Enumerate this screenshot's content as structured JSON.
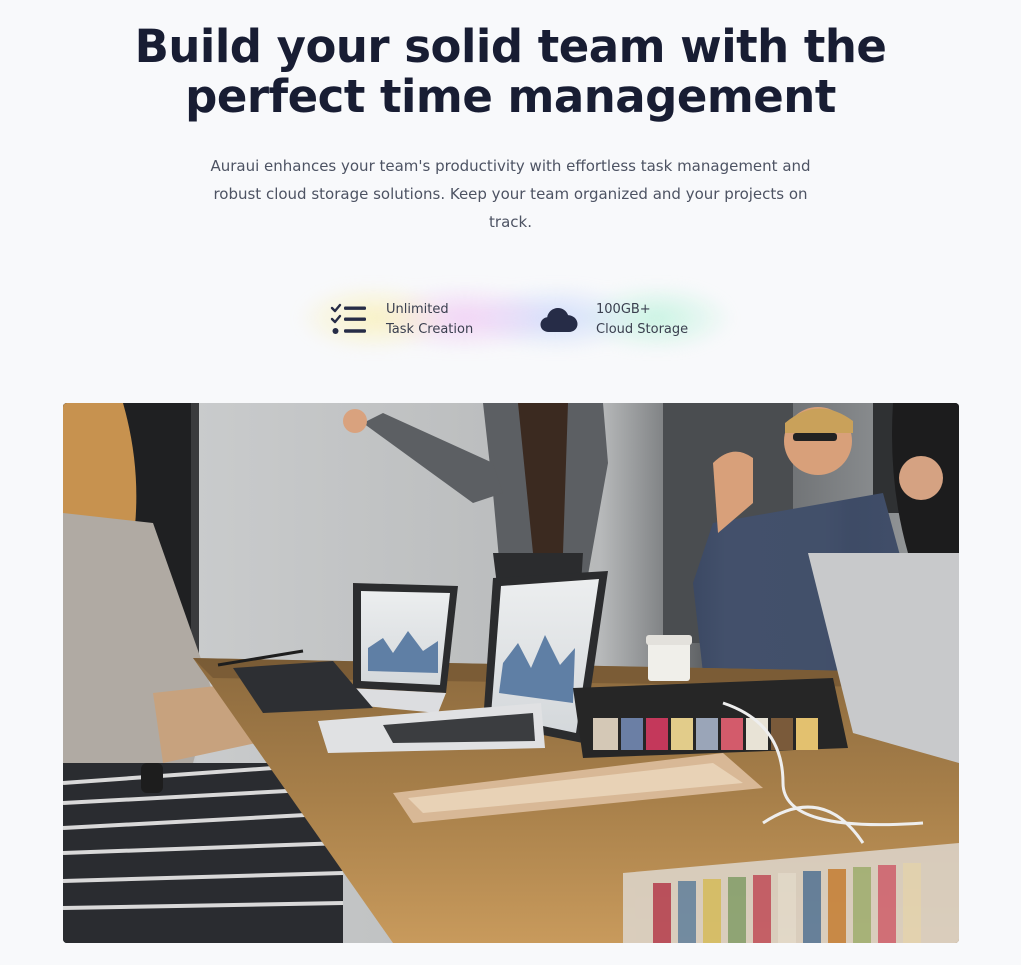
{
  "hero": {
    "headline_line1": "Build your solid team with the",
    "headline_line2": "perfect time management",
    "description": "Auraui enhances your team's productivity with effortless task management and robust cloud storage solutions. Keep your team organized and your projects on track."
  },
  "features": [
    {
      "icon": "task-list-icon",
      "line1": "Unlimited",
      "line2": "Task Creation"
    },
    {
      "icon": "cloud-icon",
      "line1": "100GB+",
      "line2": "Cloud Storage"
    }
  ],
  "photo": {
    "subject": "team-meeting-photo"
  },
  "colors": {
    "headline": "#181d33",
    "body_text": "#4d5363",
    "icon": "#262c47",
    "background": "#f8f9fb"
  }
}
